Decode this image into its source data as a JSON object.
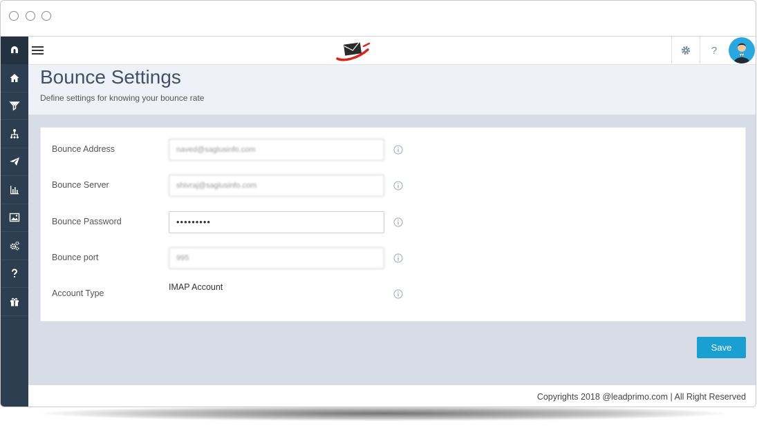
{
  "page": {
    "title": "Bounce Settings",
    "subtitle": "Define settings for knowing your bounce rate"
  },
  "sidebar": {
    "logo_icon": "magnet-icon",
    "items": [
      {
        "icon": "home-icon"
      },
      {
        "icon": "funnel-icon"
      },
      {
        "icon": "org-chart-icon"
      },
      {
        "icon": "paper-plane-icon"
      },
      {
        "icon": "bar-chart-icon"
      },
      {
        "icon": "image-icon"
      },
      {
        "icon": "gears-icon"
      },
      {
        "icon": "question-icon"
      },
      {
        "icon": "gift-icon"
      }
    ]
  },
  "topbar": {
    "settings_icon": "gear-icon",
    "help_label": "?",
    "avatar_icon": "user-avatar-icon"
  },
  "form": {
    "bounce_address": {
      "label": "Bounce Address",
      "value": "naved@saglusinfo.com"
    },
    "bounce_server": {
      "label": "Bounce Server",
      "value": "shivraj@saglusinfo.com"
    },
    "bounce_password": {
      "label": "Bounce Password",
      "value": "•••••••••"
    },
    "bounce_port": {
      "label": "Bounce port",
      "value": "995"
    },
    "account_type": {
      "label": "Account Type",
      "value": "IMAP Account"
    }
  },
  "actions": {
    "save_label": "Save"
  },
  "footer": {
    "text": "Copyrights 2018 @leadprimo.com | All Right Reserved"
  },
  "colors": {
    "sidebar": "#2c3e50",
    "accent": "#1a9fd1",
    "brand_red": "#d9261c",
    "content_bg": "#d8dce7"
  }
}
